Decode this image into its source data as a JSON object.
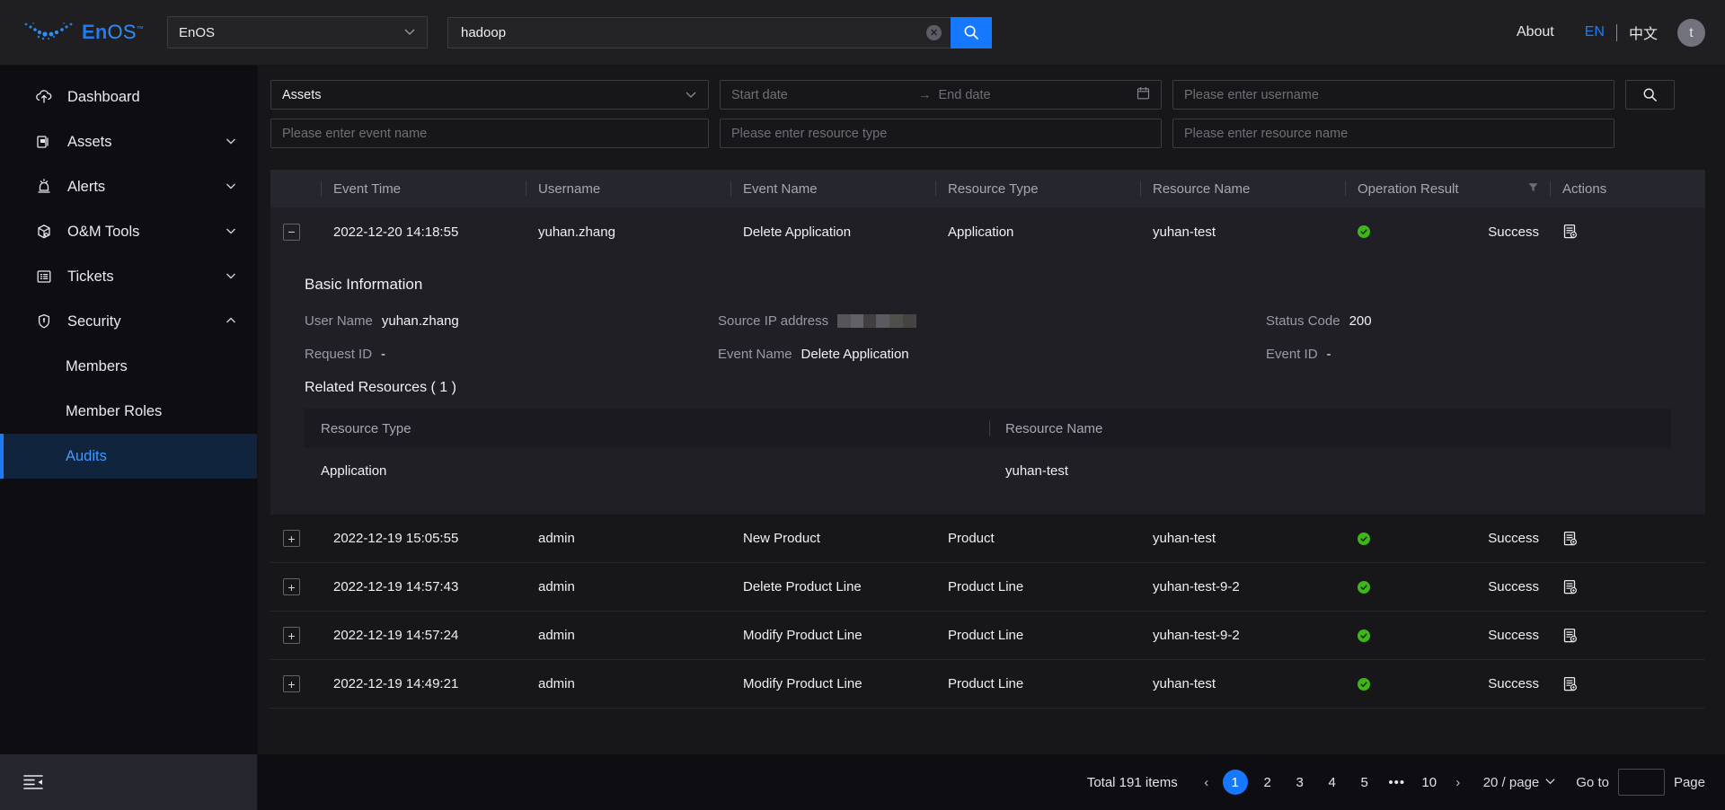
{
  "topbar": {
    "brand": "EnOS",
    "brand_prefix": "En",
    "brand_suffix": "OS",
    "brand_tm": "™",
    "org_value": "EnOS",
    "search_value": "hadoop",
    "search_icon": "search-icon",
    "clear_icon": "clear-icon",
    "about": "About",
    "lang_en": "EN",
    "lang_cn": "中文",
    "avatar_initial": "t"
  },
  "sidebar": {
    "items": [
      {
        "label": "Dashboard",
        "icon": "dashboard-icon",
        "expandable": false
      },
      {
        "label": "Assets",
        "icon": "assets-icon",
        "expandable": true
      },
      {
        "label": "Alerts",
        "icon": "alerts-icon",
        "expandable": true
      },
      {
        "label": "O&M Tools",
        "icon": "om-tools-icon",
        "expandable": true
      },
      {
        "label": "Tickets",
        "icon": "tickets-icon",
        "expandable": true
      },
      {
        "label": "Security",
        "icon": "security-icon",
        "expandable": true,
        "expanded": true
      }
    ],
    "security_children": [
      {
        "label": "Members",
        "active": false
      },
      {
        "label": "Member Roles",
        "active": false
      },
      {
        "label": "Audits",
        "active": true
      }
    ],
    "collapse_icon": "menu-collapse-icon"
  },
  "filters": {
    "scope_value": "Assets",
    "start_date_placeholder": "Start date",
    "date_separator": "→",
    "end_date_placeholder": "End date",
    "calendar_icon": "calendar-icon",
    "username_placeholder": "Please enter username",
    "search_button_icon": "search-icon",
    "event_name_placeholder": "Please enter event name",
    "resource_type_placeholder": "Please enter resource type",
    "resource_name_placeholder": "Please enter resource name"
  },
  "table": {
    "columns": [
      "Event Time",
      "Username",
      "Event Name",
      "Resource Type",
      "Resource Name",
      "Operation Result",
      "Actions"
    ],
    "filter_icon": "funnel-filter-icon",
    "rows": [
      {
        "expanded": true,
        "toggle": "−",
        "event_time": "2022-12-20 14:18:55",
        "username": "yuhan.zhang",
        "event_name": "Delete Application",
        "resource_type": "Application",
        "resource_name": "yuhan-test",
        "operation_result": "Success",
        "action_icon": "view-detail-icon"
      },
      {
        "expanded": false,
        "toggle": "+",
        "event_time": "2022-12-19 15:05:55",
        "username": "admin",
        "event_name": "New Product",
        "resource_type": "Product",
        "resource_name": "yuhan-test",
        "operation_result": "Success",
        "action_icon": "view-detail-icon"
      },
      {
        "expanded": false,
        "toggle": "+",
        "event_time": "2022-12-19 14:57:43",
        "username": "admin",
        "event_name": "Delete Product Line",
        "resource_type": "Product Line",
        "resource_name": "yuhan-test-9-2",
        "operation_result": "Success",
        "action_icon": "view-detail-icon"
      },
      {
        "expanded": false,
        "toggle": "+",
        "event_time": "2022-12-19 14:57:24",
        "username": "admin",
        "event_name": "Modify Product Line",
        "resource_type": "Product Line",
        "resource_name": "yuhan-test-9-2",
        "operation_result": "Success",
        "action_icon": "view-detail-icon"
      },
      {
        "expanded": false,
        "toggle": "+",
        "event_time": "2022-12-19 14:49:21",
        "username": "admin",
        "event_name": "Modify Product Line",
        "resource_type": "Product Line",
        "resource_name": "yuhan-test",
        "operation_result": "Success",
        "action_icon": "view-detail-icon"
      }
    ]
  },
  "detail": {
    "title": "Basic Information",
    "user_name_label": "User Name",
    "user_name_value": "yuhan.zhang",
    "source_ip_label": "Source IP address",
    "source_ip_value": "",
    "status_code_label": "Status Code",
    "status_code_value": "200",
    "request_id_label": "Request ID",
    "request_id_value": "-",
    "event_name_label": "Event Name",
    "event_name_value": "Delete Application",
    "event_id_label": "Event ID",
    "event_id_value": "-",
    "related_title": "Related Resources ( 1 )",
    "related_columns": [
      "Resource Type",
      "Resource Name"
    ],
    "related_rows": [
      {
        "resource_type": "Application",
        "resource_name": "yuhan-test"
      }
    ]
  },
  "pagination": {
    "total": "Total 191 items",
    "prev": "‹",
    "next": "›",
    "pages": [
      "1",
      "2",
      "3",
      "4",
      "5",
      "•••",
      "10"
    ],
    "active_page": "1",
    "page_size": "20 / page",
    "goto_label": "Go to",
    "goto_value": "",
    "page_label": "Page"
  },
  "colors": {
    "accent": "#1677ff",
    "success": "#3fb618",
    "sidebar_active_bg": "#10243e",
    "sidebar_active_text": "#3d9bff",
    "panel_bg": "#1f1f25",
    "page_bg": "#17171a"
  }
}
